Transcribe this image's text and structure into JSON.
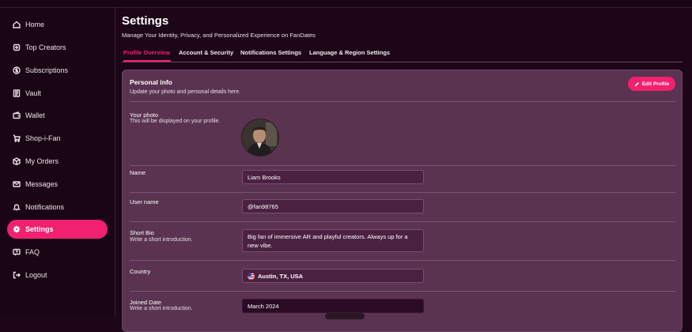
{
  "sidebar": {
    "items": [
      {
        "label": "Home",
        "icon": "home-icon"
      },
      {
        "label": "Top Creators",
        "icon": "sparkle-icon"
      },
      {
        "label": "Subscriptions",
        "icon": "dollar-icon"
      },
      {
        "label": "Vault",
        "icon": "vault-icon"
      },
      {
        "label": "Wallet",
        "icon": "wallet-icon"
      },
      {
        "label": "Shop-i-Fan",
        "icon": "cart-icon"
      },
      {
        "label": "My Orders",
        "icon": "orders-icon"
      },
      {
        "label": "Messages",
        "icon": "mail-icon"
      },
      {
        "label": "Notifications",
        "icon": "bell-icon"
      },
      {
        "label": "Settings",
        "icon": "gear-icon",
        "active": true
      },
      {
        "label": "FAQ",
        "icon": "faq-icon"
      },
      {
        "label": "Logout",
        "icon": "logout-icon"
      }
    ]
  },
  "header": {
    "title": "Settings",
    "subtitle": "Manage Your Identity, Privacy, and Personalized Experience on FanDates"
  },
  "tabs": [
    {
      "label": "Profile Overview",
      "active": true
    },
    {
      "label": "Account & Security"
    },
    {
      "label": "Notifications Settings"
    },
    {
      "label": "Language & Region Settings"
    }
  ],
  "card": {
    "title": "Personal info",
    "subtitle": "Update your photo and personal details here.",
    "edit_label": "Edit Profile",
    "photo": {
      "label": "Your photo",
      "hint": "This will be displayed on your profile."
    },
    "name": {
      "label": "Name",
      "value": "Liam Brooks"
    },
    "username": {
      "label": "User name",
      "value": "@fan98765"
    },
    "bio": {
      "label": "Short Bio",
      "hint": "Write a short introduction.",
      "value": "Big fan of immersive AR and playful creators. Always up for a new vibe."
    },
    "country": {
      "label": "Country",
      "value": "Austin, TX, USA"
    },
    "joined": {
      "label": "Joined Date",
      "hint": "Write a short introduction.",
      "value": "March 2024"
    }
  },
  "colors": {
    "accent": "#f0216f",
    "background": "#1d0617",
    "card": "#5a3350"
  }
}
